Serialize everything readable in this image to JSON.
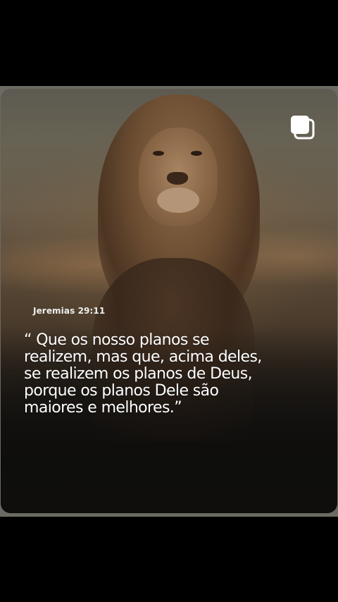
{
  "post": {
    "reference": "Jeremias 29:11",
    "quote_lines": [
      "“ Que os nosso planos se",
      "realizem, mas que, acima deles,",
      "se realizem os planos de Deus,",
      "porque os planos Dele são",
      "maiores e melhores.”"
    ],
    "image_subject": "lion-portrait",
    "multi_post_icon": "stacked-squares-icon"
  },
  "colors": {
    "background": "#000000",
    "text": "#ffffff",
    "frame": "#6b6a63"
  }
}
